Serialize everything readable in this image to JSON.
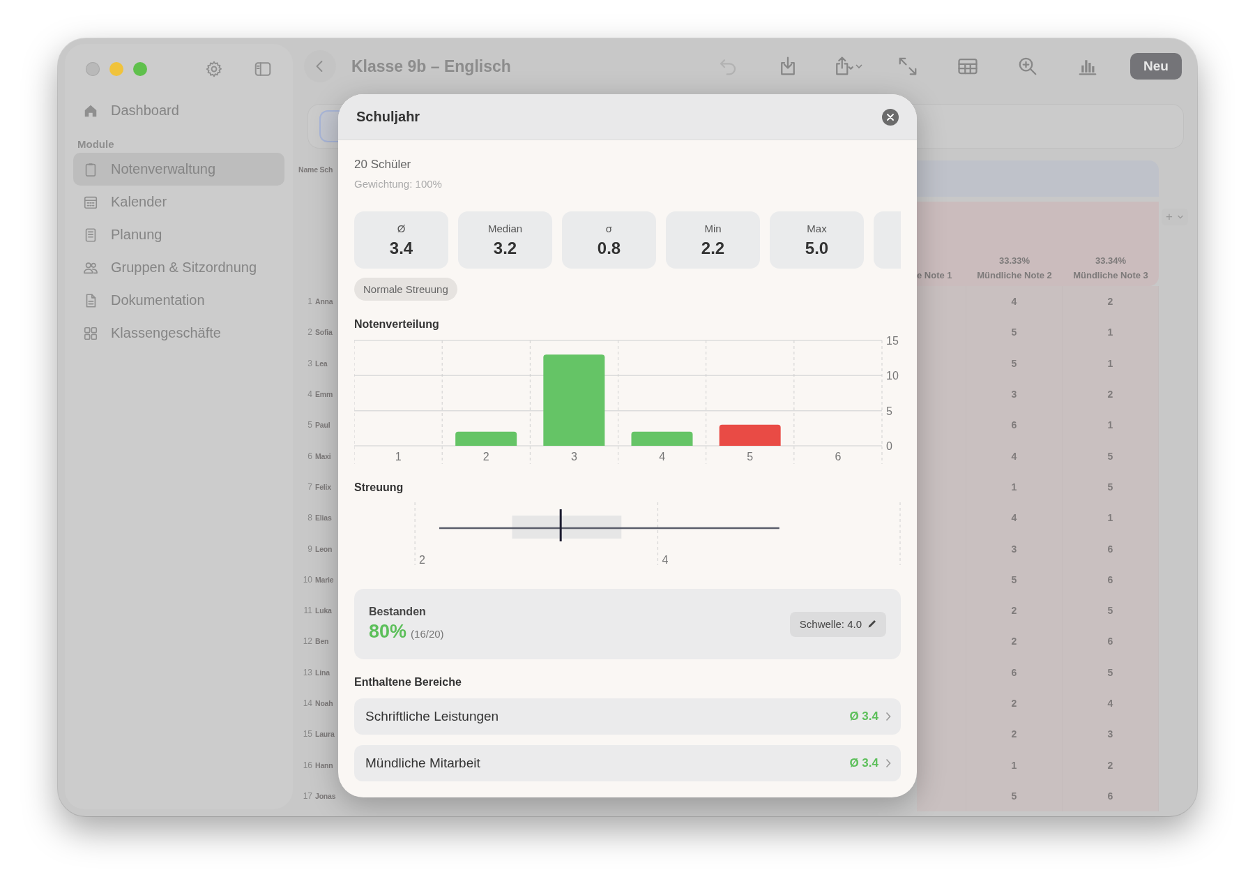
{
  "window": {
    "title": "Klasse 9b – Englisch"
  },
  "toolbar": {
    "left_buttons": [
      {
        "kind": "settings"
      },
      {
        "kind": "sidebar"
      },
      {
        "kind": "back"
      }
    ],
    "buttons": [
      {
        "kind": "undo",
        "disabled": true
      },
      {
        "kind": "download",
        "disabled": false
      },
      {
        "kind": "share",
        "disabled": false
      },
      {
        "kind": "expand",
        "disabled": false
      },
      {
        "kind": "table",
        "disabled": false
      },
      {
        "kind": "zoom",
        "disabled": false
      },
      {
        "kind": "chart",
        "disabled": false
      }
    ],
    "new_button": "Neu"
  },
  "sidebar": {
    "top_item": {
      "label": "Dashboard",
      "kind": "house"
    },
    "section": "Module",
    "items": [
      {
        "label": "Notenverwaltung",
        "kind": "clipboard",
        "selected": true
      },
      {
        "label": "Kalender",
        "kind": "calendar",
        "selected": false
      },
      {
        "label": "Planung",
        "kind": "notes",
        "selected": false
      },
      {
        "label": "Gruppen & Sitzordnung",
        "kind": "people",
        "selected": false
      },
      {
        "label": "Dokumentation",
        "kind": "document",
        "selected": false
      },
      {
        "label": "Klassengeschäfte",
        "kind": "grid",
        "selected": false
      }
    ]
  },
  "table": {
    "name_header": "Name Sch",
    "add_button": "+",
    "cut_column_header": "e Note 1",
    "columns": [
      {
        "weight": "33.33%",
        "label": "Mündliche Note 2"
      },
      {
        "weight": "33.34%",
        "label": "Mündliche Note 3"
      }
    ],
    "rows": [
      {
        "number": "1",
        "name": "Anna",
        "cells": [
          "4",
          "2"
        ]
      },
      {
        "number": "2",
        "name": "Sofia",
        "cells": [
          "5",
          "1"
        ]
      },
      {
        "number": "3",
        "name": "Lea",
        "cells": [
          "5",
          "1"
        ]
      },
      {
        "number": "4",
        "name": "Emm",
        "cells": [
          "3",
          "2"
        ]
      },
      {
        "number": "5",
        "name": "Paul",
        "cells": [
          "6",
          "1"
        ]
      },
      {
        "number": "6",
        "name": "Maxi",
        "cells": [
          "4",
          "5"
        ]
      },
      {
        "number": "7",
        "name": "Felix",
        "cells": [
          "1",
          "5"
        ]
      },
      {
        "number": "8",
        "name": "Elias",
        "cells": [
          "4",
          "1"
        ]
      },
      {
        "number": "9",
        "name": "Leon",
        "cells": [
          "3",
          "6"
        ]
      },
      {
        "number": "10",
        "name": "Marie",
        "cells": [
          "5",
          "6"
        ]
      },
      {
        "number": "11",
        "name": "Luka",
        "cells": [
          "2",
          "5"
        ]
      },
      {
        "number": "12",
        "name": "Ben",
        "cells": [
          "2",
          "6"
        ]
      },
      {
        "number": "13",
        "name": "Lina",
        "cells": [
          "6",
          "5"
        ]
      },
      {
        "number": "14",
        "name": "Noah",
        "cells": [
          "2",
          "4"
        ]
      },
      {
        "number": "15",
        "name": "Laura",
        "cells": [
          "2",
          "3"
        ]
      },
      {
        "number": "16",
        "name": "Hann",
        "cells": [
          "1",
          "2"
        ]
      },
      {
        "number": "17",
        "name": "Jonas",
        "cells": [
          "5",
          "6"
        ]
      }
    ]
  },
  "modal": {
    "title": "Schuljahr",
    "students": "20 Schüler",
    "weighting": "Gewichtung: 100%",
    "stats": [
      {
        "kind": "stat",
        "label": "Ø",
        "value": "3.4"
      },
      {
        "kind": "stat",
        "label": "Median",
        "value": "3.2"
      },
      {
        "kind": "stat",
        "label": "σ",
        "value": "0.8"
      },
      {
        "kind": "stat",
        "label": "Min",
        "value": "2.2"
      },
      {
        "kind": "stat",
        "label": "Max",
        "value": "5.0"
      },
      {
        "kind": "clipped"
      }
    ],
    "spread_badge": "Normale Streuung",
    "distribution": {
      "heading": "Notenverteilung",
      "chart_data": {
        "type": "bar",
        "categories": [
          "1",
          "2",
          "3",
          "4",
          "5",
          "6"
        ],
        "stacked": true,
        "ylim": [
          0,
          15
        ],
        "yticks": [
          0,
          5,
          10,
          15
        ],
        "series": [
          {
            "color": "#65c466",
            "values": [
              0,
              2,
              13,
              2,
              null,
              0
            ]
          },
          {
            "color": "#e94b45",
            "values": [
              null,
              null,
              null,
              null,
              3,
              null
            ]
          }
        ]
      }
    },
    "spread": {
      "heading": "Streuung",
      "axis_labels": [
        "2",
        "4"
      ]
    },
    "pass": {
      "label": "Bestanden",
      "percent": "80%",
      "count": "(16/20)",
      "threshold_button": "Schwelle: 4.0"
    },
    "sections": {
      "heading": "Enthaltene Bereiche",
      "items": [
        {
          "label": "Schriftliche Leistungen",
          "average": "Ø 3.4"
        },
        {
          "label": "Mündliche Mitarbeit",
          "average": "Ø 3.4"
        }
      ]
    }
  }
}
